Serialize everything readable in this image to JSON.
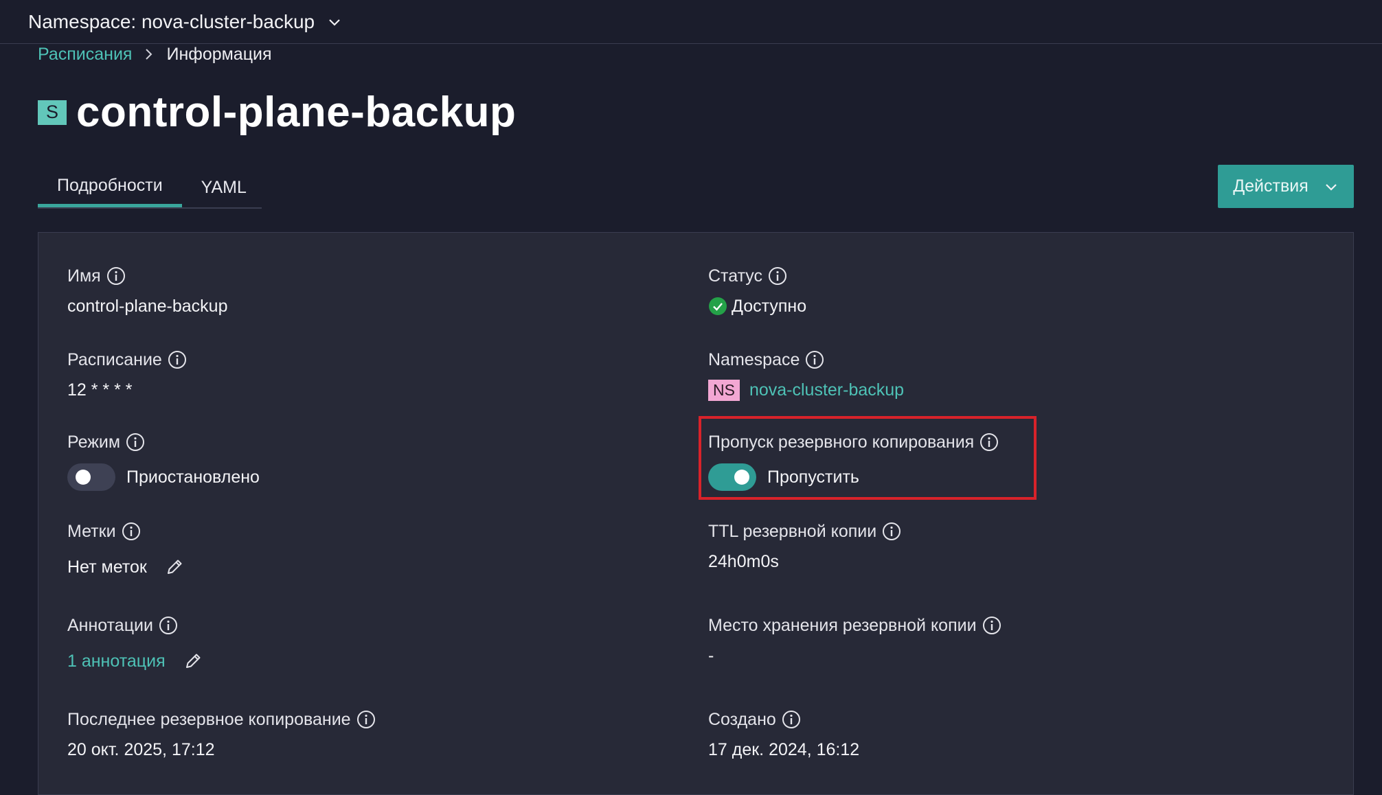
{
  "topbar": {
    "namespace_label": "Namespace: nova-cluster-backup",
    "chevron_icon": "chevron-down-icon"
  },
  "breadcrumb": {
    "parent": "Расписания",
    "current": "Информация"
  },
  "header": {
    "kind_badge": "S",
    "title": "control-plane-backup"
  },
  "tabs": [
    {
      "label": "Подробности",
      "active": true
    },
    {
      "label": "YAML",
      "active": false
    }
  ],
  "actions": {
    "label": "Действия"
  },
  "details": {
    "name": {
      "label": "Имя",
      "value": "control-plane-backup"
    },
    "schedule": {
      "label": "Расписание",
      "value": "12 * * * *"
    },
    "mode": {
      "label": "Режим",
      "value": "Приостановлено",
      "toggle_on": false
    },
    "labels": {
      "label": "Метки",
      "value": "Нет меток"
    },
    "annotations": {
      "label": "Аннотации",
      "value": "1 аннотация"
    },
    "last_backup": {
      "label": "Последнее резервное копирование",
      "value": "20 окт. 2025, 17:12"
    },
    "status": {
      "label": "Статус",
      "value": "Доступно",
      "color": "#24a148"
    },
    "namespace": {
      "label": "Namespace",
      "badge": "NS",
      "value": "nova-cluster-backup"
    },
    "skip_backup": {
      "label": "Пропуск резервного копирования",
      "value": "Пропустить",
      "toggle_on": true
    },
    "ttl": {
      "label": "TTL резервной копии",
      "value": "24h0m0s"
    },
    "storage": {
      "label": "Место хранения резервной копии",
      "value": "-"
    },
    "created": {
      "label": "Создано",
      "value": "17 дек. 2024, 16:12"
    }
  },
  "colors": {
    "accent": "#2f9c95",
    "link": "#4ec2b6",
    "background": "#1b1d2c",
    "panel": "#272937",
    "highlight": "#d8222a"
  }
}
